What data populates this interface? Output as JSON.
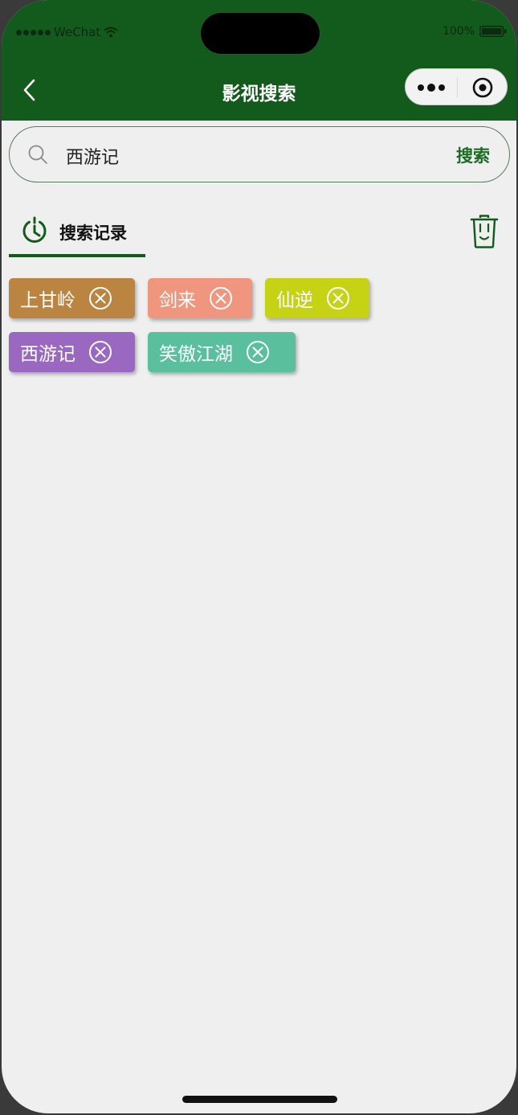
{
  "status_bar": {
    "carrier": "WeChat",
    "battery": "100%"
  },
  "nav": {
    "title": "影视搜索"
  },
  "search": {
    "value": "西游记",
    "placeholder": "",
    "button_label": "搜索"
  },
  "history": {
    "title": "搜索记录",
    "items": [
      {
        "label": "上甘岭",
        "color": "#bb8440"
      },
      {
        "label": "剑来",
        "color": "#f0967e"
      },
      {
        "label": "仙逆",
        "color": "#c6d214"
      },
      {
        "label": "西游记",
        "color": "#9a68c0"
      },
      {
        "label": "笑傲江湖",
        "color": "#5abf9c"
      }
    ]
  },
  "theme": {
    "primary": "#135a1d",
    "accent": "#1b6b24",
    "background": "#efefef"
  },
  "icons": [
    "back-icon",
    "more-icon",
    "close-miniprogram-icon",
    "search-icon",
    "history-clock-icon",
    "trash-icon",
    "close-circle-icon"
  ]
}
